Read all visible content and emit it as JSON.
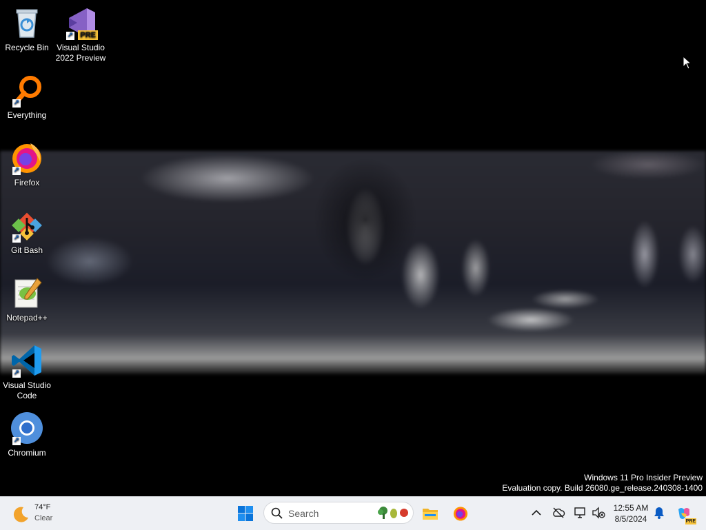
{
  "desktop": {
    "icons": [
      {
        "label": "Recycle Bin",
        "icon": "recycle-bin-icon"
      },
      {
        "label": "Visual Studio 2022 Preview",
        "icon": "visual-studio-preview-icon",
        "badge": "PRE"
      },
      {
        "label": "Everything",
        "icon": "everything-search-icon"
      },
      {
        "label": "Firefox",
        "icon": "firefox-icon"
      },
      {
        "label": "Git Bash",
        "icon": "git-bash-icon"
      },
      {
        "label": "Notepad++",
        "icon": "notepad-plus-plus-icon"
      },
      {
        "label": "Visual Studio Code",
        "icon": "vscode-icon"
      },
      {
        "label": "Chromium",
        "icon": "chromium-icon"
      }
    ],
    "watermark": {
      "line1": "Windows 11 Pro Insider Preview",
      "line2": "Evaluation copy. Build 26080.ge_release.240308-1400"
    }
  },
  "taskbar": {
    "weather": {
      "temp": "74°F",
      "condition": "Clear",
      "icon": "moon-icon"
    },
    "search_placeholder": "Search",
    "pinned": [
      "start-icon",
      "file-explorer-icon",
      "firefox-icon"
    ],
    "tray": [
      "chevron-up-icon",
      "onedrive-offline-icon",
      "network-icon",
      "volume-muted-icon"
    ],
    "clock": {
      "time": "12:55 AM",
      "date": "8/5/2024"
    },
    "copilot_badge": "PRE"
  },
  "colors": {
    "taskbar_bg": "#eef0f4",
    "accent": "#0078d4"
  }
}
